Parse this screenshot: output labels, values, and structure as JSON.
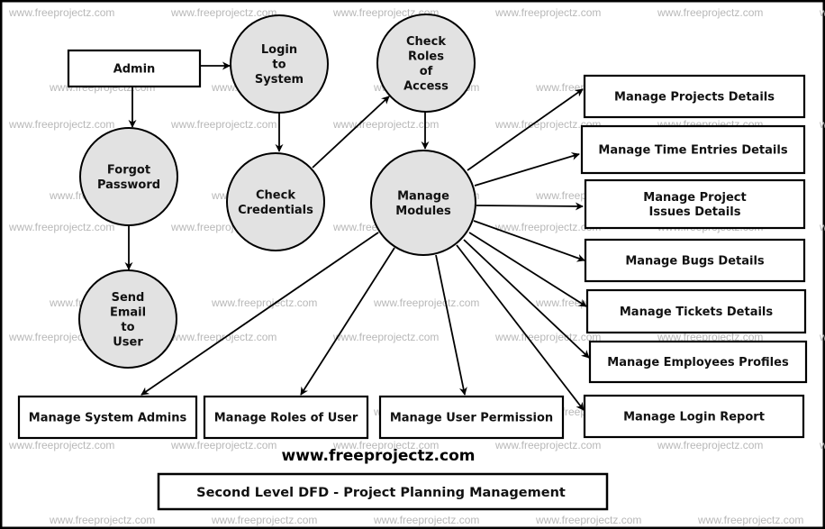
{
  "diagram": {
    "title": "Second Level DFD - Project Planning Management",
    "website": "www.freeprojectz.com",
    "watermark": "www.freeprojectz.com",
    "colors": {
      "process_fill": "#e2e2e2",
      "stroke": "#000000",
      "watermark": "#b8b8b8",
      "background": "#ffffff"
    },
    "entities": [
      {
        "id": "admin",
        "lines": [
          "Admin"
        ]
      },
      {
        "id": "manage-projects-details",
        "lines": [
          "Manage Projects Details"
        ]
      },
      {
        "id": "manage-time-entries-details",
        "lines": [
          "Manage Time Entries Details"
        ]
      },
      {
        "id": "manage-project-issues-details",
        "lines": [
          "Manage Project",
          "Issues Details"
        ]
      },
      {
        "id": "manage-bugs-details",
        "lines": [
          "Manage Bugs Details"
        ]
      },
      {
        "id": "manage-tickets-details",
        "lines": [
          "Manage Tickets Details"
        ]
      },
      {
        "id": "manage-employees-profiles",
        "lines": [
          "Manage Employees Profiles"
        ]
      },
      {
        "id": "manage-login-report",
        "lines": [
          "Manage Login Report"
        ]
      },
      {
        "id": "manage-system-admins",
        "lines": [
          "Manage System Admins"
        ]
      },
      {
        "id": "manage-roles-of-user",
        "lines": [
          "Manage Roles of User"
        ]
      },
      {
        "id": "manage-user-permission",
        "lines": [
          "Manage User Permission"
        ]
      }
    ],
    "processes": [
      {
        "id": "login-to-system",
        "lines": [
          "Login",
          "to",
          "System"
        ]
      },
      {
        "id": "check-roles-of-access",
        "lines": [
          "Check",
          "Roles",
          "of",
          "Access"
        ]
      },
      {
        "id": "forgot-password",
        "lines": [
          "Forgot",
          "Password"
        ]
      },
      {
        "id": "check-credentials",
        "lines": [
          "Check",
          "Credentials"
        ]
      },
      {
        "id": "manage-modules",
        "lines": [
          "Manage",
          "Modules"
        ]
      },
      {
        "id": "send-email-to-user",
        "lines": [
          "Send",
          "Email",
          "to",
          "User"
        ]
      }
    ],
    "flows": [
      {
        "from": "admin",
        "to": "login-to-system"
      },
      {
        "from": "admin",
        "to": "forgot-password"
      },
      {
        "from": "login-to-system",
        "to": "check-credentials"
      },
      {
        "from": "check-credentials",
        "to": "check-roles-of-access"
      },
      {
        "from": "check-roles-of-access",
        "to": "manage-modules"
      },
      {
        "from": "forgot-password",
        "to": "send-email-to-user"
      },
      {
        "from": "manage-modules",
        "to": "manage-projects-details"
      },
      {
        "from": "manage-modules",
        "to": "manage-time-entries-details"
      },
      {
        "from": "manage-modules",
        "to": "manage-project-issues-details"
      },
      {
        "from": "manage-modules",
        "to": "manage-bugs-details"
      },
      {
        "from": "manage-modules",
        "to": "manage-tickets-details"
      },
      {
        "from": "manage-modules",
        "to": "manage-employees-profiles"
      },
      {
        "from": "manage-modules",
        "to": "manage-login-report"
      },
      {
        "from": "manage-modules",
        "to": "manage-user-permission"
      },
      {
        "from": "manage-modules",
        "to": "manage-roles-of-user"
      },
      {
        "from": "manage-modules",
        "to": "manage-system-admins"
      }
    ]
  }
}
